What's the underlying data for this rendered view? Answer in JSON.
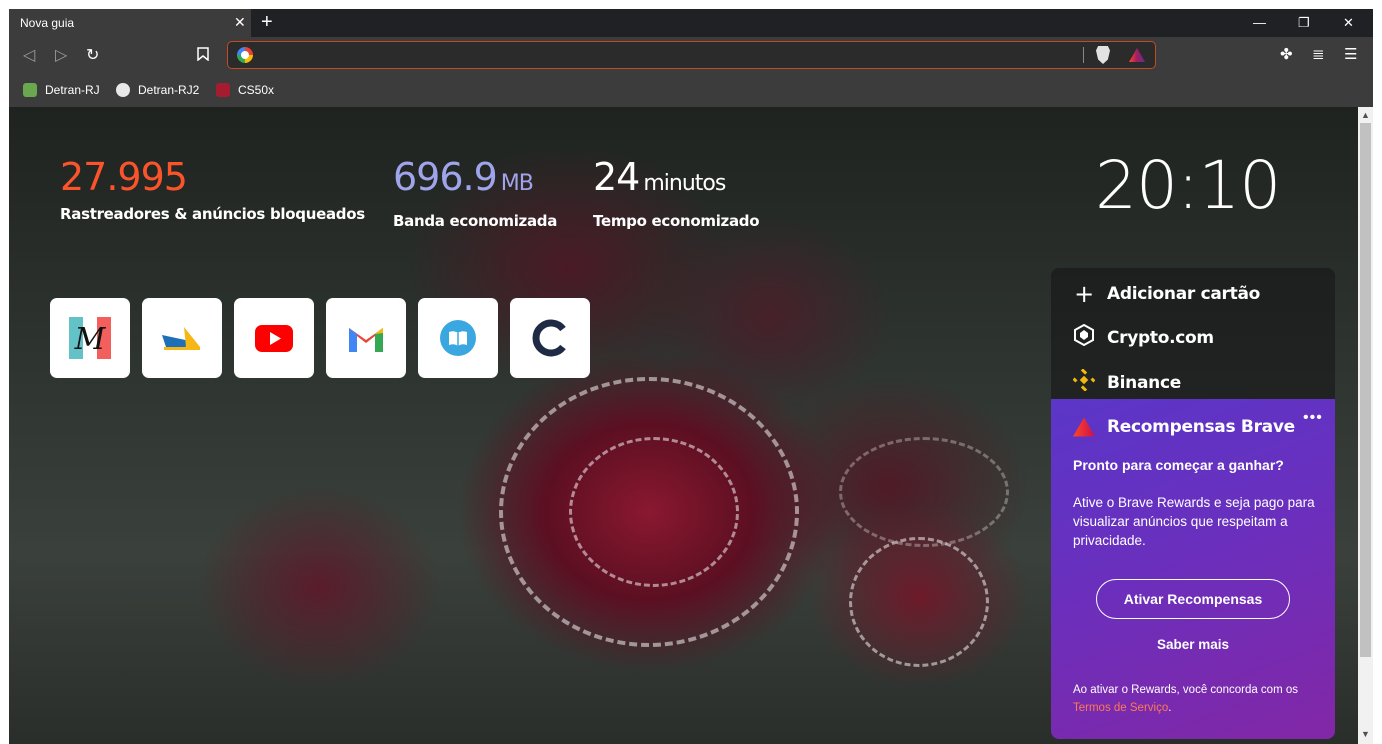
{
  "tab": {
    "title": "Nova guia",
    "close": "✕",
    "new_tab": "+"
  },
  "window_controls": {
    "minimize": "—",
    "maximize": "❐",
    "close": "✕"
  },
  "toolbar": {
    "back": "◁",
    "forward": "▷",
    "reload": "↻",
    "bookmark": "🔖",
    "address_value": "",
    "extensions": "✤",
    "media": "≣",
    "menu": "☰"
  },
  "bookmarks": [
    {
      "label": "Detran-RJ",
      "color": "#6aa84f"
    },
    {
      "label": "Detran-RJ2",
      "color": "#e8e8e8"
    },
    {
      "label": "CS50x",
      "color": "#a51c30"
    }
  ],
  "stats": {
    "trackers": {
      "value": "27.995",
      "label": "Rastreadores & anúncios bloqueados",
      "color": "#fb542b"
    },
    "bandwidth": {
      "value": "696.9",
      "unit": "MB",
      "label": "Banda economizada",
      "color": "#a0a5eb"
    },
    "time": {
      "value": "24",
      "unit": "minutos",
      "label": "Tempo economizado",
      "color": "#ffffff"
    }
  },
  "clock": "20:10",
  "tiles": [
    {
      "name": "medium-icon"
    },
    {
      "name": "site-bird-icon"
    },
    {
      "name": "youtube-icon"
    },
    {
      "name": "gmail-icon"
    },
    {
      "name": "book-icon"
    },
    {
      "name": "coursera-icon"
    }
  ],
  "cards": {
    "add": {
      "icon": "+",
      "label": "Adicionar cartão"
    },
    "crypto": {
      "label": "Crypto.com"
    },
    "binance": {
      "label": "Binance"
    }
  },
  "rewards": {
    "title": "Recompensas Brave",
    "menu": "•••",
    "subtitle": "Pronto para começar a ganhar?",
    "description": "Ative o Brave Rewards e seja pago para visualizar anúncios que respeitam a privacidade.",
    "button": "Ativar Recompensas",
    "learn_more": "Saber mais",
    "terms_prefix": "Ao ativar o Rewards, você concorda com os",
    "terms_link": "Termos de Serviço",
    "terms_suffix": "."
  }
}
